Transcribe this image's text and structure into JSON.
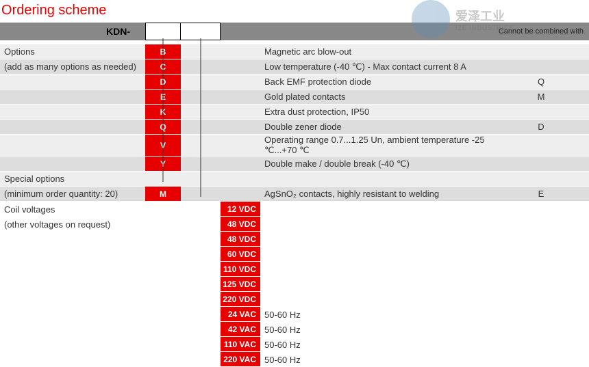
{
  "title": "Ordering scheme",
  "prefix": "KDN-",
  "cannot_label": "Cannot be combined with",
  "watermark": {
    "line1": "爱泽工业",
    "line2": "IZE INDUSTRIES"
  },
  "section_options": {
    "line1": "Options",
    "line2": "(add as many options as needed)"
  },
  "section_special": {
    "line1": "Special options",
    "line2": "(minimum order quantity: 20)"
  },
  "section_coil": {
    "line1": "Coil voltages",
    "line2": "(other voltages on request)"
  },
  "options": [
    {
      "code": "B",
      "desc": "Magnetic arc blow-out",
      "not": ""
    },
    {
      "code": "C",
      "desc": "Low temperature (-40 ℃) - Max contact current 8 A",
      "not": ""
    },
    {
      "code": "D",
      "desc": "Back EMF protection diode",
      "not": "Q"
    },
    {
      "code": "E",
      "desc": "Gold plated contacts",
      "not": "M"
    },
    {
      "code": "K",
      "desc": "Extra dust protection, IP50",
      "not": ""
    },
    {
      "code": "Q",
      "desc": "Double zener diode",
      "not": "D"
    },
    {
      "code": "V",
      "desc": "Operating range 0.7...1.25 Un, ambient temperature -25 ℃...+70 ℃",
      "not": ""
    },
    {
      "code": "Y",
      "desc": "Double make / double break (-40 ℃)",
      "not": ""
    }
  ],
  "special": [
    {
      "code": "M",
      "desc": "AgSnO₂ contacts, highly resistant to welding",
      "not": "E"
    }
  ],
  "voltages": [
    {
      "code": "12 VDC",
      "desc": ""
    },
    {
      "code": "48 VDC",
      "desc": ""
    },
    {
      "code": "48 VDC",
      "desc": ""
    },
    {
      "code": "60 VDC",
      "desc": ""
    },
    {
      "code": "110 VDC",
      "desc": ""
    },
    {
      "code": "125 VDC",
      "desc": ""
    },
    {
      "code": "220 VDC",
      "desc": ""
    },
    {
      "code": "24 VAC",
      "desc": "50-60 Hz"
    },
    {
      "code": "42 VAC",
      "desc": "50-60 Hz"
    },
    {
      "code": "110 VAC",
      "desc": "50-60 Hz"
    },
    {
      "code": "220 VAC",
      "desc": "50-60 Hz"
    }
  ]
}
